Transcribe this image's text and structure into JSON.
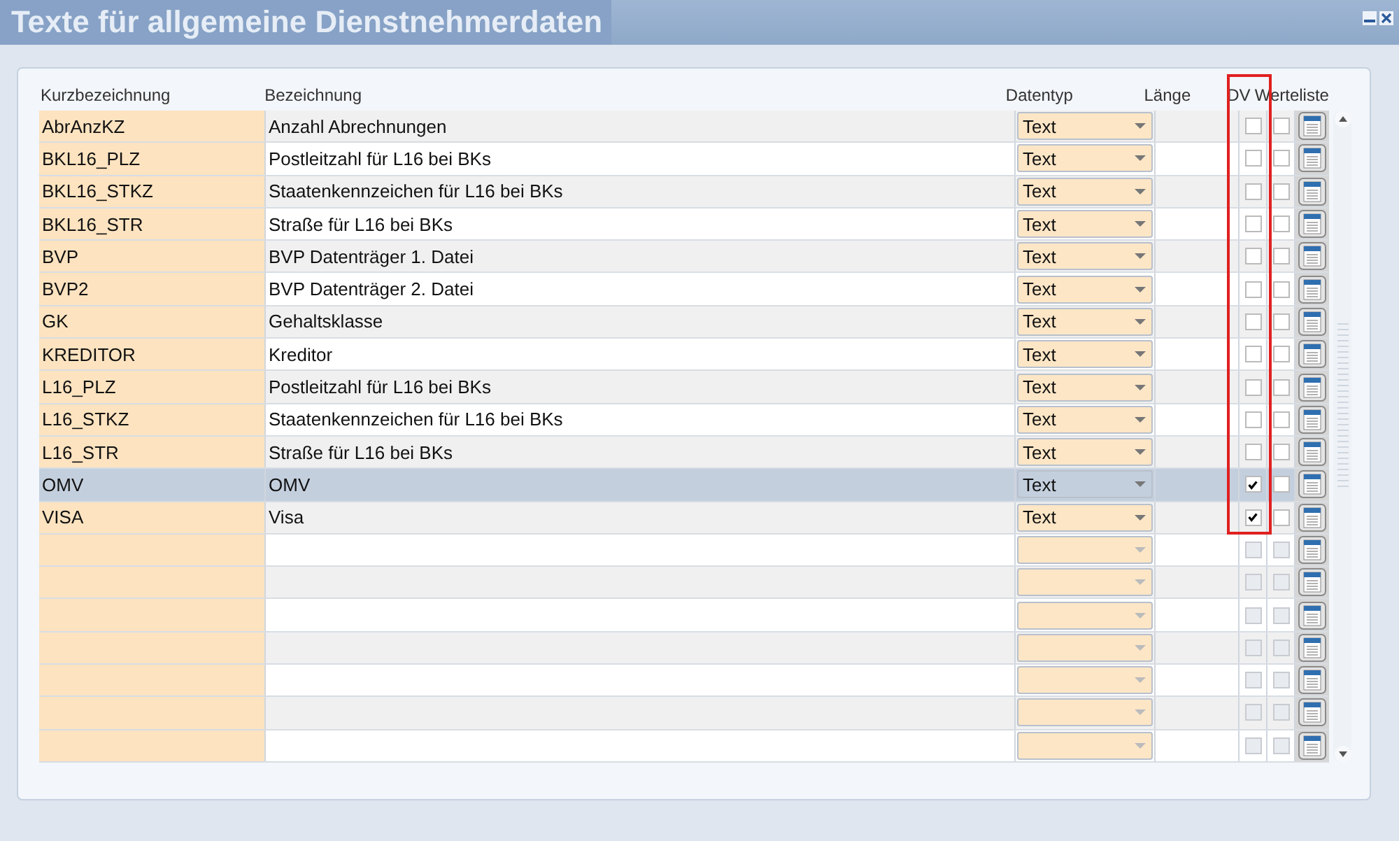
{
  "window": {
    "title": "Texte für allgemeine Dienstnehmerdaten"
  },
  "columns": [
    {
      "label": "Kurzbezeichnung"
    },
    {
      "label": "Bezeichnung"
    },
    {
      "label": "Datentyp"
    },
    {
      "label": "Länge"
    },
    {
      "label": "DV"
    },
    {
      "label": "Werteliste"
    }
  ],
  "dv_highlight": true,
  "rows": [
    {
      "kind": "filled",
      "short": "AbrAnzKZ",
      "name": "Anzahl Abrechnungen",
      "type": "Text",
      "dv": false,
      "list": false,
      "selected": false
    },
    {
      "kind": "filled",
      "short": "BKL16_PLZ",
      "name": "Postleitzahl für L16 bei BKs",
      "type": "Text",
      "dv": false,
      "list": false,
      "selected": false
    },
    {
      "kind": "filled",
      "short": "BKL16_STKZ",
      "name": "Staatenkennzeichen für L16 bei BKs",
      "type": "Text",
      "dv": false,
      "list": false,
      "selected": false
    },
    {
      "kind": "filled",
      "short": "BKL16_STR",
      "name": "Straße für L16 bei BKs",
      "type": "Text",
      "dv": false,
      "list": false,
      "selected": false
    },
    {
      "kind": "filled",
      "short": "BVP",
      "name": "BVP Datenträger 1. Datei",
      "type": "Text",
      "dv": false,
      "list": false,
      "selected": false
    },
    {
      "kind": "filled",
      "short": "BVP2",
      "name": "BVP Datenträger 2. Datei",
      "type": "Text",
      "dv": false,
      "list": false,
      "selected": false
    },
    {
      "kind": "filled",
      "short": "GK",
      "name": "Gehaltsklasse",
      "type": "Text",
      "dv": false,
      "list": false,
      "selected": false
    },
    {
      "kind": "filled",
      "short": "KREDITOR",
      "name": "Kreditor",
      "type": "Text",
      "dv": false,
      "list": false,
      "selected": false
    },
    {
      "kind": "filled",
      "short": "L16_PLZ",
      "name": "Postleitzahl für L16 bei BKs",
      "type": "Text",
      "dv": false,
      "list": false,
      "selected": false
    },
    {
      "kind": "filled",
      "short": "L16_STKZ",
      "name": "Staatenkennzeichen für L16 bei BKs",
      "type": "Text",
      "dv": false,
      "list": false,
      "selected": false
    },
    {
      "kind": "filled",
      "short": "L16_STR",
      "name": "Straße für L16 bei BKs",
      "type": "Text",
      "dv": false,
      "list": false,
      "selected": false
    },
    {
      "kind": "filled",
      "short": "OMV",
      "name": "OMV",
      "type": "Text",
      "dv": true,
      "list": false,
      "selected": true
    },
    {
      "kind": "filled",
      "short": "VISA",
      "name": "Visa",
      "type": "Text",
      "dv": true,
      "list": false,
      "selected": false
    },
    {
      "kind": "empty",
      "dv": false,
      "list": false,
      "selected": false
    },
    {
      "kind": "empty",
      "dv": false,
      "list": false,
      "selected": false
    },
    {
      "kind": "empty",
      "dv": false,
      "list": false,
      "selected": false
    },
    {
      "kind": "empty",
      "dv": false,
      "list": false,
      "selected": false
    },
    {
      "kind": "empty",
      "dv": false,
      "list": false,
      "selected": false
    },
    {
      "kind": "empty",
      "dv": false,
      "list": false,
      "selected": false
    },
    {
      "kind": "empty",
      "dv": false,
      "list": false,
      "selected": false
    }
  ]
}
